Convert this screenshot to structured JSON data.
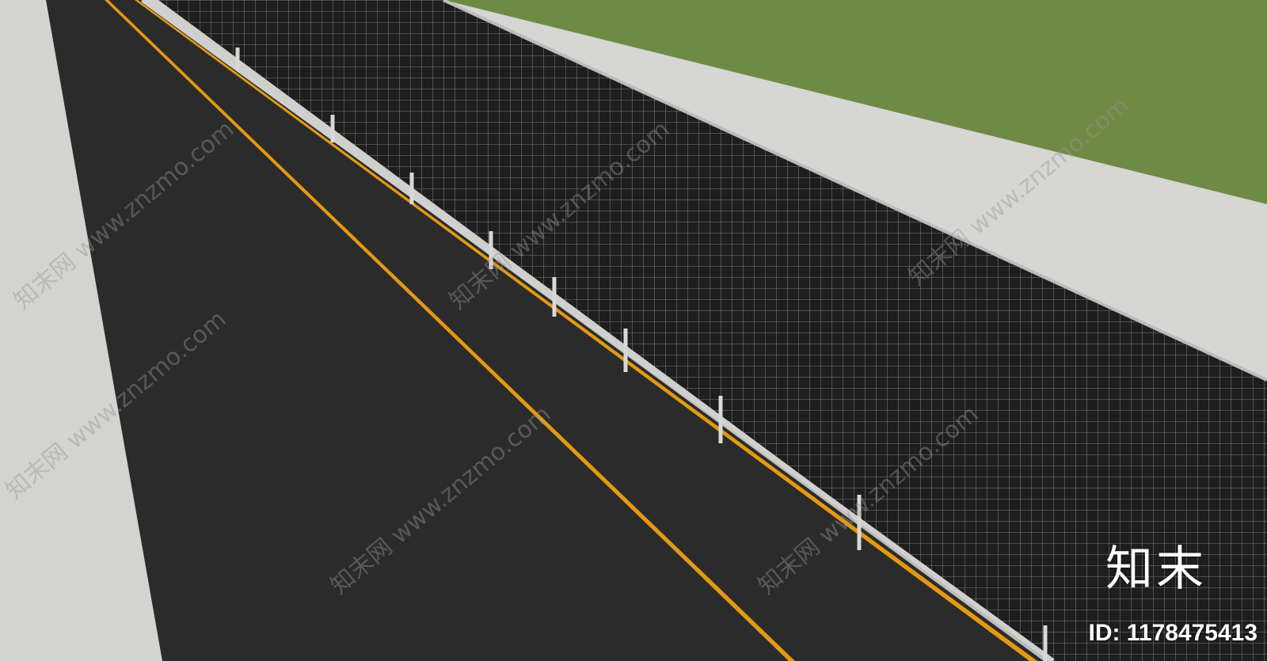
{
  "scene": {
    "description_tags": [
      "road",
      "solar-panel-canopy",
      "sidewalk",
      "grass"
    ],
    "colors": {
      "ground": "#d3d3cf",
      "grass": "#6e8a45",
      "asphalt": "#2a2a2a",
      "lane_line": "#e39a12",
      "panel": "#1c1c1c",
      "panel_grid": "#bfbfbf",
      "frame": "#c8c8c8"
    }
  },
  "watermarks": [
    {
      "text": "知末网 www.znzmo.com"
    },
    {
      "text": "知末网 www.znzmo.com"
    },
    {
      "text": "知末网 www.znzmo.com"
    },
    {
      "text": "知末网 www.znzmo.com"
    },
    {
      "text": "知末网 www.znzmo.com"
    },
    {
      "text": "知末网 www.znzmo.com"
    }
  ],
  "brand": {
    "logo_text": "知末",
    "id_text": "ID: 1178475413"
  }
}
